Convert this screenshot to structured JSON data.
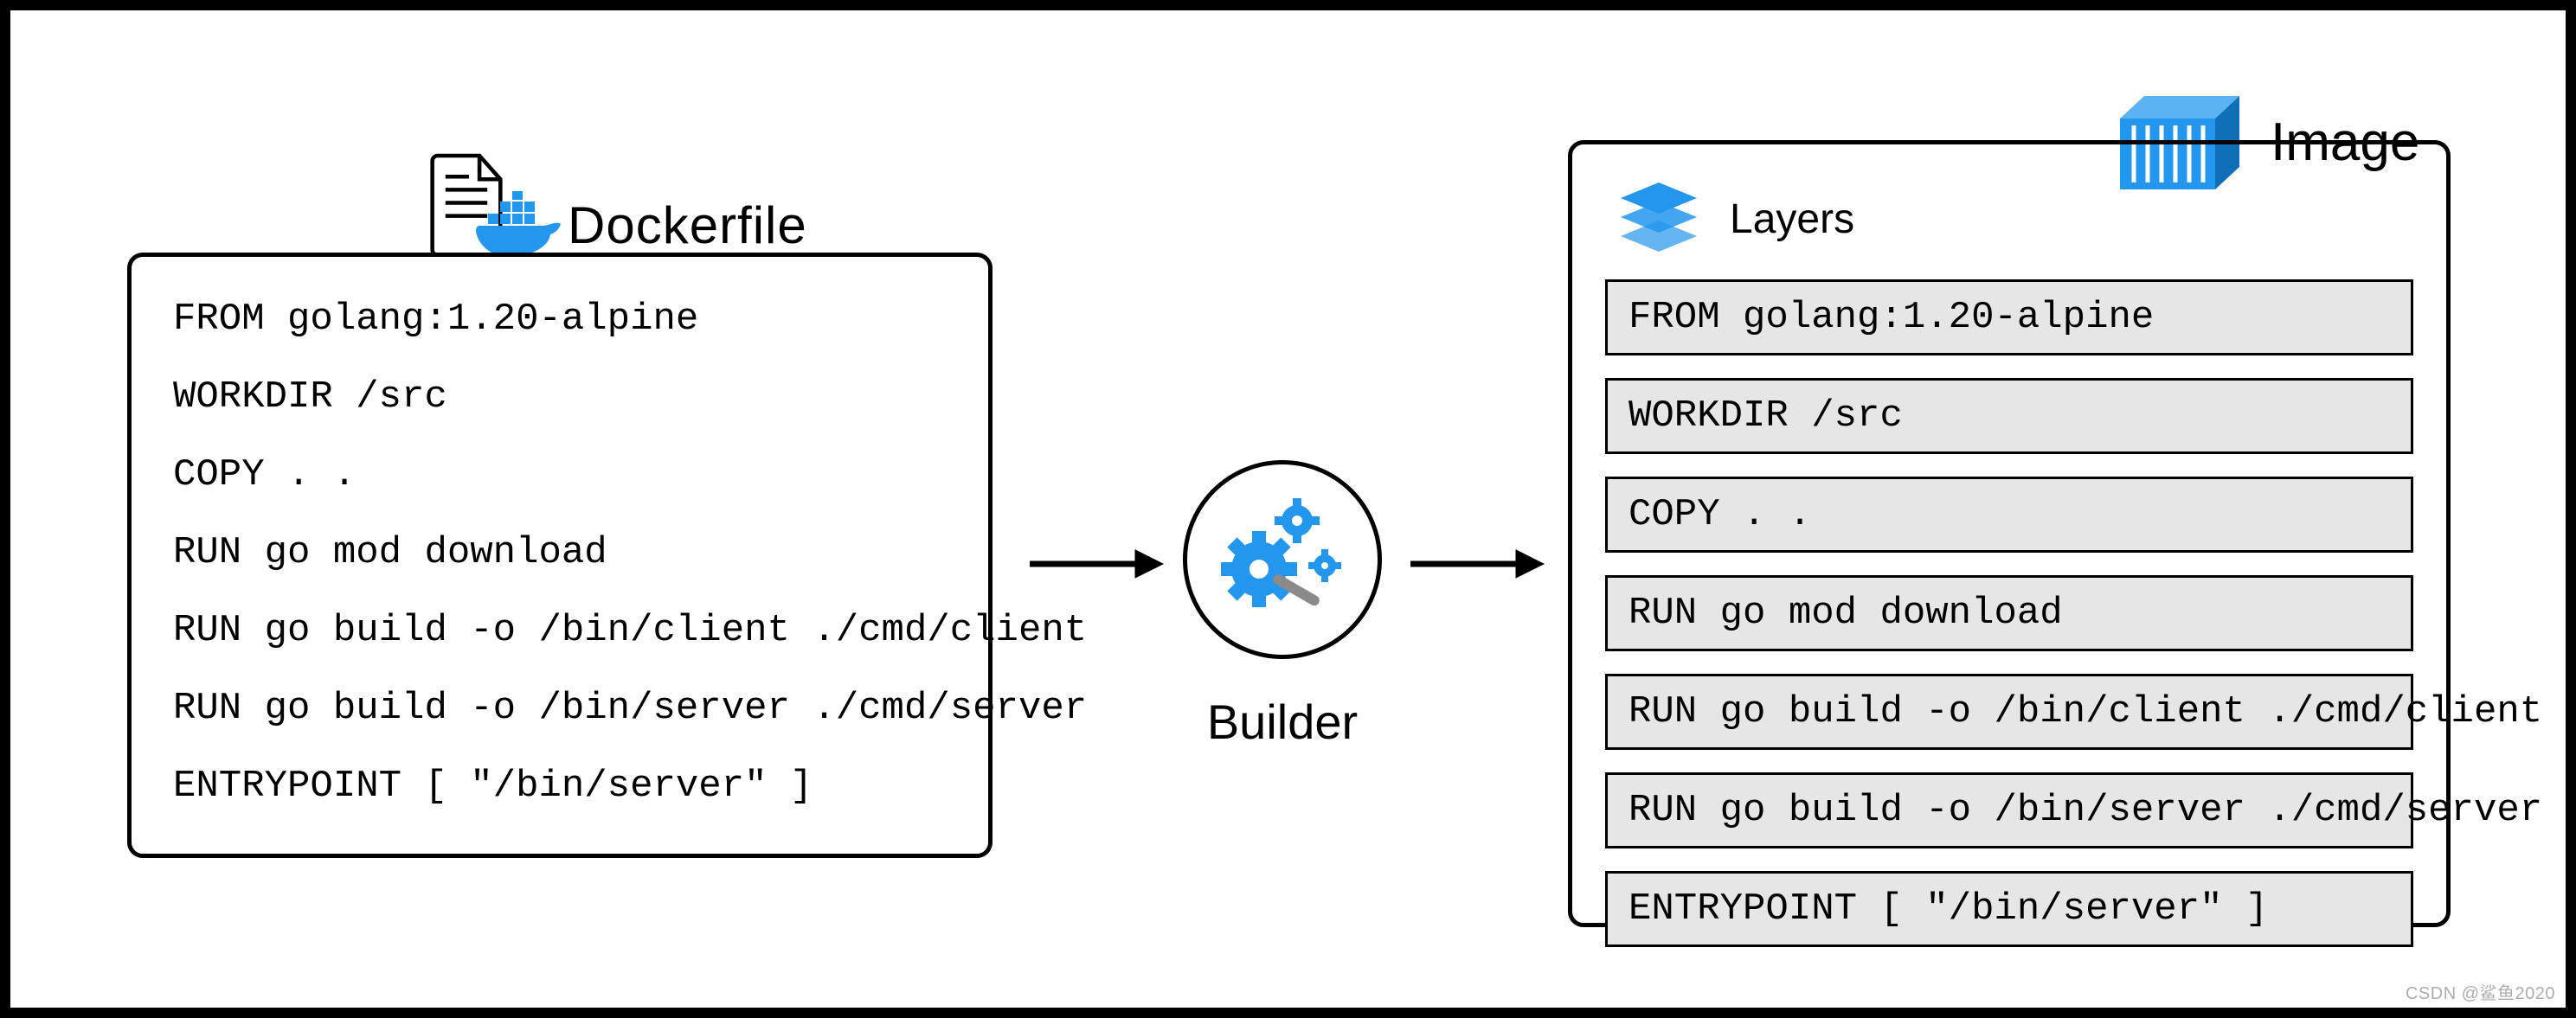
{
  "dockerfile": {
    "title": "Dockerfile",
    "lines": [
      "FROM golang:1.20-alpine",
      "WORKDIR /src",
      "COPY . .",
      "RUN go mod download",
      "RUN go build -o /bin/client ./cmd/client",
      "RUN go build -o /bin/server ./cmd/server",
      "ENTRYPOINT [ \"/bin/server\" ]"
    ]
  },
  "builder": {
    "label": "Builder"
  },
  "image": {
    "title": "Image",
    "layers_label": "Layers",
    "layers": [
      "FROM golang:1.20-alpine",
      "WORKDIR /src",
      "COPY . .",
      "RUN go mod download",
      "RUN go build -o /bin/client ./cmd/client",
      "RUN go build -o /bin/server ./cmd/server",
      "ENTRYPOINT [ \"/bin/server\" ]"
    ]
  },
  "icons": {
    "file": "file-icon",
    "docker_whale": "docker-whale-icon",
    "gears": "gears-icon",
    "container": "container-icon",
    "layers_stack": "layers-stack-icon"
  },
  "colors": {
    "accent_blue": "#2396ed",
    "layer_bg": "#e6e6e6",
    "border": "#000000"
  },
  "watermark": "CSDN @鲨鱼2020"
}
